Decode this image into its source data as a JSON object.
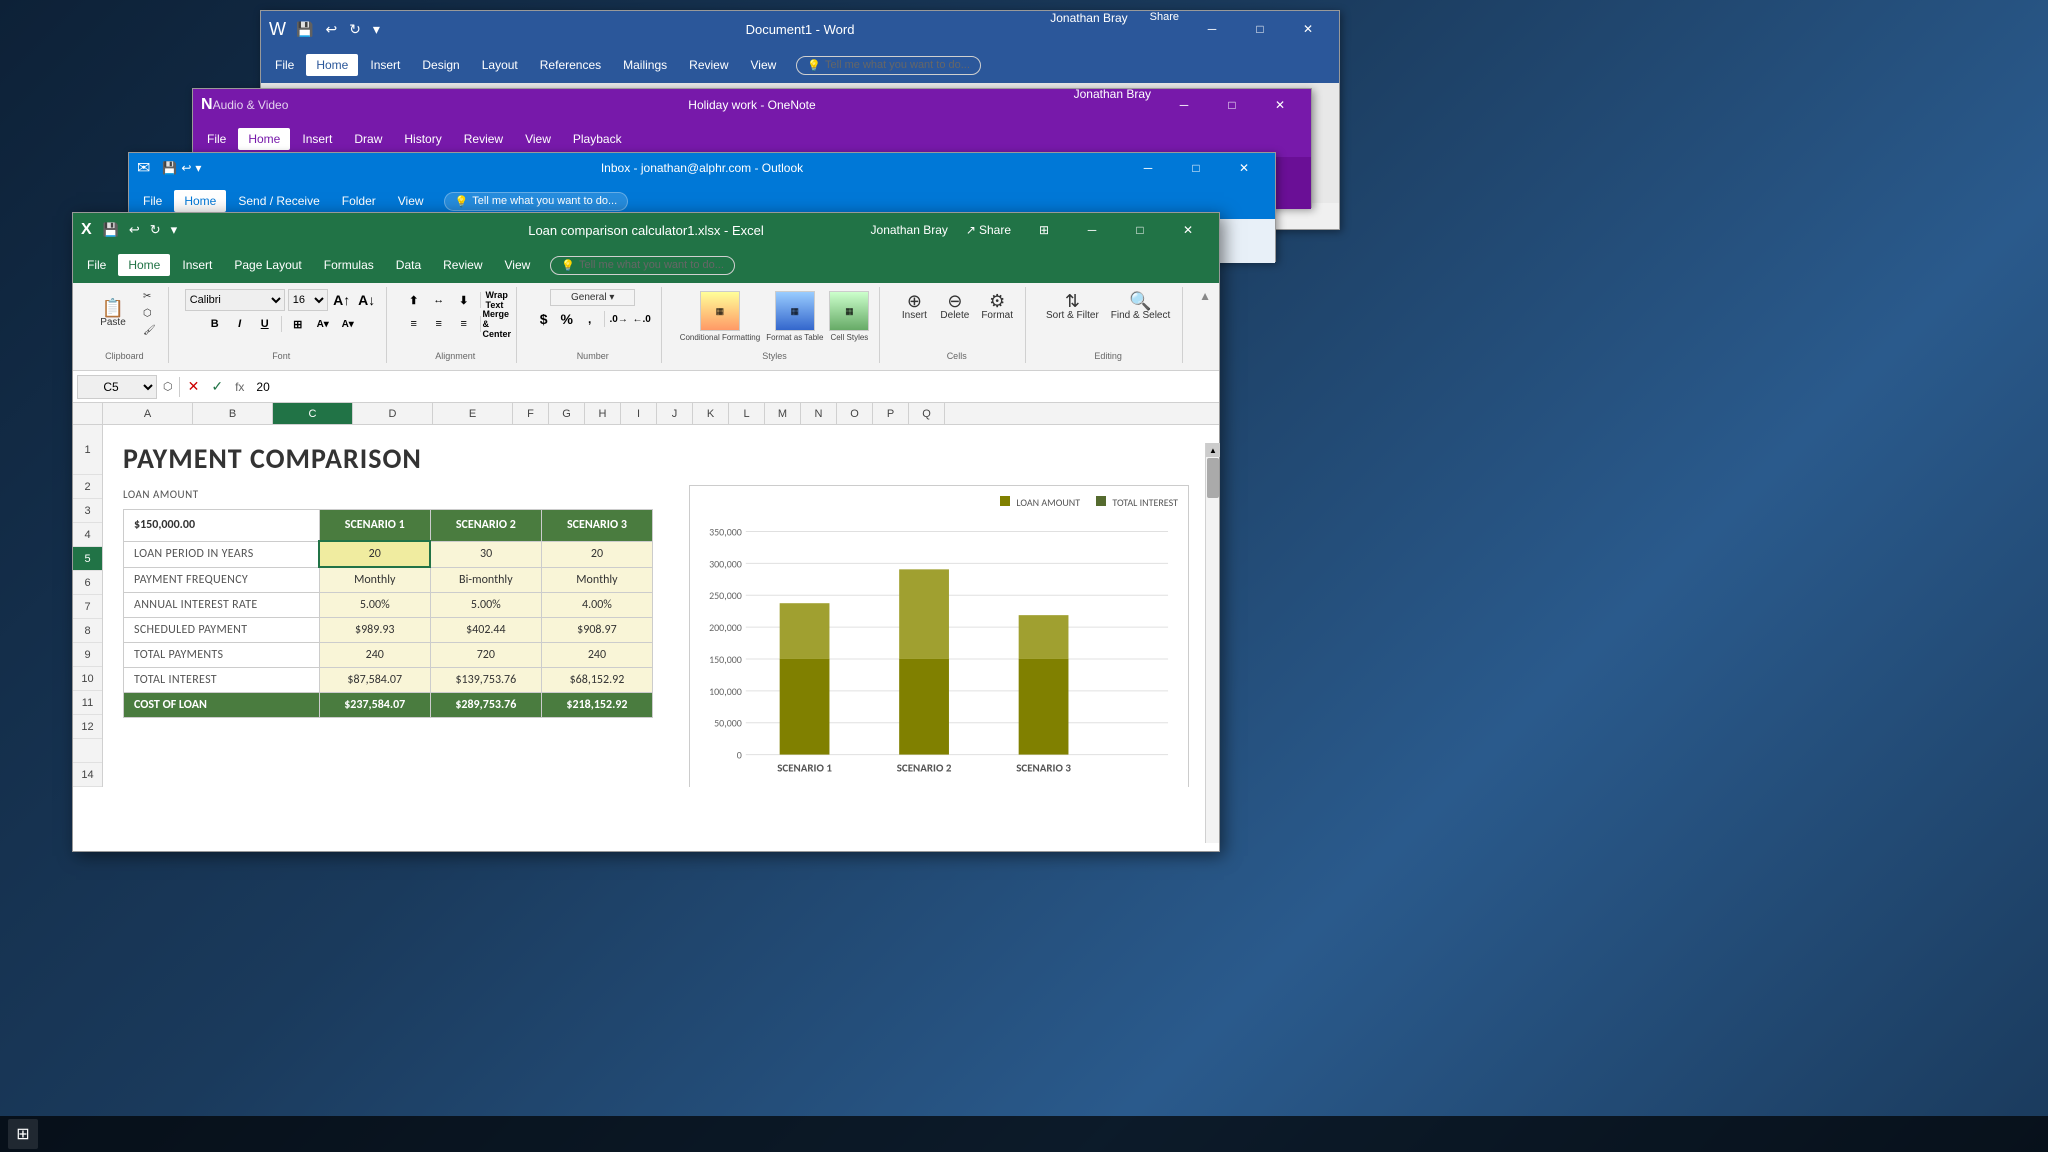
{
  "desktop": {
    "background": "#1a3a5c"
  },
  "word_window": {
    "title": "Document1 - Word",
    "menu_items": [
      "File",
      "Home",
      "Insert",
      "Design",
      "Layout",
      "References",
      "Mailings",
      "Review",
      "View"
    ],
    "active_tab": "Home",
    "tell_me": "Tell me what you want to do...",
    "user": "Jonathan Bray",
    "share": "Share",
    "qs_buttons": [
      "💾",
      "↩",
      "↻",
      "⚡"
    ]
  },
  "onenote_window": {
    "title": "Holiday work - OneNote",
    "right_title": "Audio & Video",
    "menu_items": [
      "File",
      "Home",
      "Insert",
      "Draw",
      "History",
      "Review",
      "View",
      "Playback"
    ],
    "active_tab": "Home",
    "user": "Jonathan Bray"
  },
  "outlook_window": {
    "title": "Inbox - jonathan@alphr.com - Outlook",
    "menu_items": [
      "File",
      "Home",
      "Send / Receive",
      "Folder",
      "View"
    ],
    "active_tab": "Home",
    "tell_me": "Tell me what you want to do..."
  },
  "excel_window": {
    "title": "Loan comparison calculator1.xlsx - Excel",
    "user": "Jonathan Bray",
    "share": "Share",
    "tell_me": "Tell me what you want to do...",
    "cell_ref": "C5",
    "formula_value": "20",
    "font_name": "Calibri",
    "font_size": "16",
    "menu_items": [
      "File",
      "Home",
      "Insert",
      "Page Layout",
      "Formulas",
      "Data",
      "Review",
      "View"
    ],
    "active_tab": "Home",
    "col_headers": [
      "A",
      "B",
      "C",
      "D",
      "E",
      "F",
      "G",
      "H",
      "I",
      "J",
      "K",
      "L",
      "M",
      "N",
      "O",
      "P",
      "Q"
    ],
    "row_headers": [
      "1",
      "2",
      "3",
      "4",
      "5",
      "6",
      "7",
      "8",
      "9",
      "10",
      "11",
      "12",
      "14"
    ],
    "ribbon": {
      "clipboard_group": "Clipboard",
      "font_group": "Font",
      "alignment_group": "Alignment",
      "number_group": "Number",
      "styles_group": "Styles",
      "cells_group": "Cells",
      "editing_group": "Editing",
      "paste_label": "Paste",
      "conditional_formatting": "Conditional Formatting",
      "format_as_table": "Format as Table",
      "cell_styles": "Cell Styles",
      "insert_label": "Insert",
      "delete_label": "Delete",
      "format_label": "Format",
      "sort_filter": "Sort & Filter",
      "find_select": "Find & Select",
      "wrap_text": "Wrap Text",
      "merge_center": "Merge & Center"
    }
  },
  "spreadsheet": {
    "title": "PAYMENT COMPARISON",
    "loan_amount_label": "LOAN AMOUNT",
    "loan_amount_value": "$150,000.00",
    "scenario1_label": "SCENARIO 1",
    "scenario2_label": "SCENARIO 2",
    "scenario3_label": "SCENARIO 3",
    "rows": [
      {
        "label": "LOAN PERIOD IN YEARS",
        "s1": "20",
        "s2": "30",
        "s3": "20"
      },
      {
        "label": "PAYMENT FREQUENCY",
        "s1": "Monthly",
        "s2": "Bi-monthly",
        "s3": "Monthly"
      },
      {
        "label": "ANNUAL INTEREST RATE",
        "s1": "5.00%",
        "s2": "5.00%",
        "s3": "4.00%"
      },
      {
        "label": "SCHEDULED PAYMENT",
        "s1": "$989.93",
        "s2": "$402.44",
        "s3": "$908.97"
      },
      {
        "label": "TOTAL PAYMENTS",
        "s1": "240",
        "s2": "720",
        "s3": "240"
      },
      {
        "label": "TOTAL INTEREST",
        "s1": "$87,584.07",
        "s2": "$139,753.76",
        "s3": "$68,152.92"
      },
      {
        "label": "COST OF LOAN",
        "s1": "$237,584.07",
        "s2": "$289,753.76",
        "s3": "$218,152.92"
      }
    ],
    "chart": {
      "legend_loan": "LOAN AMOUNT",
      "legend_interest": "TOTAL INTEREST",
      "scenarios": [
        "SCENARIO 1",
        "SCENARIO 2",
        "SCENARIO 3"
      ],
      "loan_amount": 150000,
      "interest_s1": 87584,
      "interest_s2": 139754,
      "interest_s3": 68153,
      "y_labels": [
        "350,000",
        "300,000",
        "250,000",
        "200,000",
        "150,000",
        "100,000",
        "50,000",
        "0"
      ]
    }
  },
  "icons": {
    "close": "✕",
    "minimize": "─",
    "maximize": "□",
    "restore": "❐",
    "save": "💾",
    "undo": "↩",
    "redo": "↻",
    "expand": "⊞",
    "search": "🔍",
    "lightbulb": "💡",
    "person": "👤",
    "share_icon": "↗",
    "arrow_down": "▾",
    "check": "✓",
    "cross": "✕",
    "fx": "fx"
  },
  "colors": {
    "word_blue": "#2b579a",
    "onenote_purple": "#7719aa",
    "outlook_blue": "#0078d7",
    "excel_green": "#217346",
    "excel_dark_green": "#4a7c3f",
    "scenario_yellow": "#f9f5d7",
    "scenario_header_green": "#4a7c3f",
    "chart_dark_green": "#4a7c3f",
    "chart_yellow_green": "#a8b800",
    "selected_row_bg": "#f0eca0"
  }
}
